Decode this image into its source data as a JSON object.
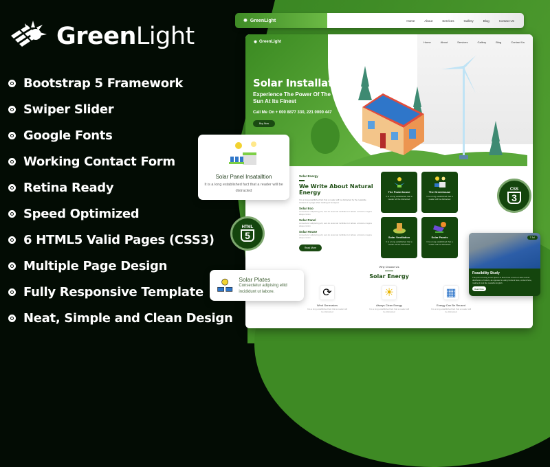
{
  "brand": {
    "name_bold": "Green",
    "name_light": "Light"
  },
  "features": [
    "Bootstrap 5 Framework",
    "Swiper Slider",
    "Google Fonts",
    "Working Contact Form",
    "Retina Ready",
    "Speed Optimized",
    "6 HTML5 Valid Pages (CSS3)",
    "Multiple Page Design",
    "Fully Responsive Template",
    "Neat, Simple and Clean Design"
  ],
  "nav": {
    "logo": "GreenLight",
    "links": [
      "Home",
      "About",
      "Services",
      "Gallery",
      "Blog",
      "Contact Us"
    ]
  },
  "hero": {
    "title": "Solar Installations",
    "subtitle": "Experience The Power Of The Sun At Its Finest",
    "call": "Call Me On + 000 8877 330, 221 0000 447",
    "button": "Buy Now"
  },
  "about": {
    "kicker": "Solar Energy",
    "title": "We Write About Natural Energy",
    "intro": "It is a long established fact that a reader will be distracted by the readable content of a page when looking at its layout.",
    "items": [
      {
        "title": "Solar Eco",
        "text": "consectetur adipiscing elit, sed do eiusmod incididunt ut labore et dolore magna aliqua minim"
      },
      {
        "title": "Solar Panel",
        "text": "consectetur adipiscing elit, sed do eiusmod incididunt ut labore et dolore magna aliqua minim"
      },
      {
        "title": "Solar House",
        "text": "consectetur adipiscing elit, sed do eiusmod incididunt ut labore et dolore magna aliqua minim"
      }
    ],
    "button": "Read More"
  },
  "service_cards": [
    {
      "title": "The Powerhouse",
      "text": "It is a long established that a reader will be distracted"
    },
    {
      "title": "The Greenhouse",
      "text": "It is a long established that a reader will be distracted"
    },
    {
      "title": "Solar Ventilation",
      "text": "It is a long established that a reader will be distracted"
    },
    {
      "title": "Solar Panels",
      "text": "It is a long established that a reader will be distracted"
    }
  ],
  "why": {
    "kicker": "Why Choose Us",
    "title": "Solar Energy",
    "items": [
      {
        "title": "Wind Generators",
        "text": "It is a long established fact that a reader will be distracted"
      },
      {
        "title": "Always Clean Energy",
        "text": "It is a long established fact that a reader will be distracted"
      },
      {
        "title": "Energy Can Be Reused",
        "text": "It is a long established fact that a reader will be distracted"
      }
    ]
  },
  "float_install": {
    "title": "Solar Panel Insatalltion",
    "text": "It is a long established fact that a reader will be distracted"
  },
  "float_plates": {
    "title": "Solar Plates",
    "text": "Consectetur adipising elitd incididunt ut labore."
  },
  "badges": {
    "css": "CSS",
    "css_num": "3",
    "html": "HTML",
    "html_num": "5"
  },
  "study": {
    "tag": "7 Jul",
    "title": "Feasibility Study",
    "text": "The point of using Lorem Ipsum is that it has a more-or-less normal distribution of letters, as opposed to using Content here, content here, making it look like readable English.",
    "button": "Read More"
  },
  "colors": {
    "brand_green": "#3f8c26",
    "dark_green": "#14450d",
    "background": "#030c04"
  }
}
